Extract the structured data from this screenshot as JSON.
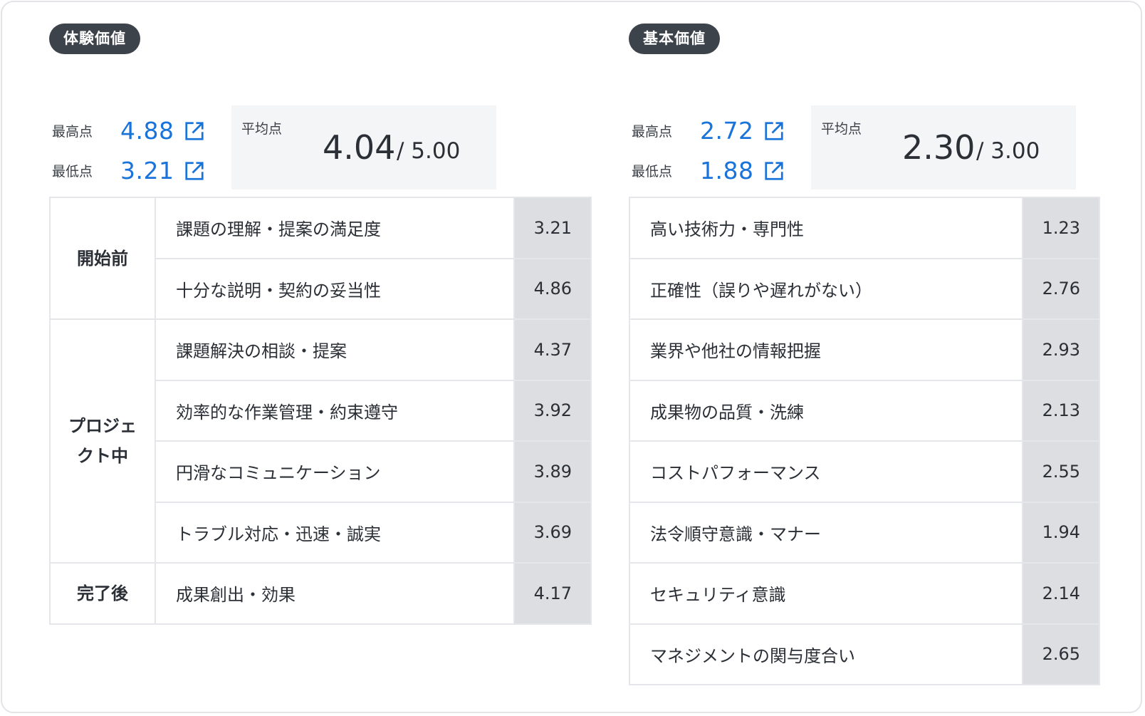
{
  "experience": {
    "tag": "体験価値",
    "max_label": "最高点",
    "max_value": "4.88",
    "min_label": "最低点",
    "min_value": "3.21",
    "avg_label": "平均点",
    "avg_value": "4.04",
    "avg_total": "/ 5.00",
    "groups": [
      {
        "phase": "開始前",
        "items": [
          {
            "label": "課題の理解・提案の満足度",
            "value": "3.21"
          },
          {
            "label": "十分な説明・契約の妥当性",
            "value": "4.86"
          }
        ]
      },
      {
        "phase": "プロジェクト中",
        "items": [
          {
            "label": "課題解決の相談・提案",
            "value": "4.37"
          },
          {
            "label": "効率的な作業管理・約束遵守",
            "value": "3.92"
          },
          {
            "label": "円滑なコミュニケーション",
            "value": "3.89"
          },
          {
            "label": "トラブル対応・迅速・誠実",
            "value": "3.69"
          }
        ]
      },
      {
        "phase": "完了後",
        "items": [
          {
            "label": "成果創出・効果",
            "value": "4.17"
          }
        ]
      }
    ]
  },
  "basic": {
    "tag": "基本価値",
    "max_label": "最高点",
    "max_value": "2.72",
    "min_label": "最低点",
    "min_value": "1.88",
    "avg_label": "平均点",
    "avg_value": "2.30",
    "avg_total": "/ 3.00",
    "items": [
      {
        "label": "高い技術力・専門性",
        "value": "1.23"
      },
      {
        "label": "正確性（誤りや遅れがない）",
        "value": "2.76"
      },
      {
        "label": "業界や他社の情報把握",
        "value": "2.93"
      },
      {
        "label": "成果物の品質・洗練",
        "value": "2.13"
      },
      {
        "label": "コストパフォーマンス",
        "value": "2.55"
      },
      {
        "label": "法令順守意識・マナー",
        "value": "1.94"
      },
      {
        "label": "セキュリティ意識",
        "value": "2.14"
      },
      {
        "label": "マネジメントの関与度合い",
        "value": "2.65"
      }
    ]
  },
  "colors": {
    "accent": "#1a73d9",
    "tag_bg": "#3d434b",
    "value_cell_bg": "#dcdee1",
    "avg_box_bg": "#f4f5f7"
  },
  "icons": {
    "link": "external-link-icon"
  }
}
